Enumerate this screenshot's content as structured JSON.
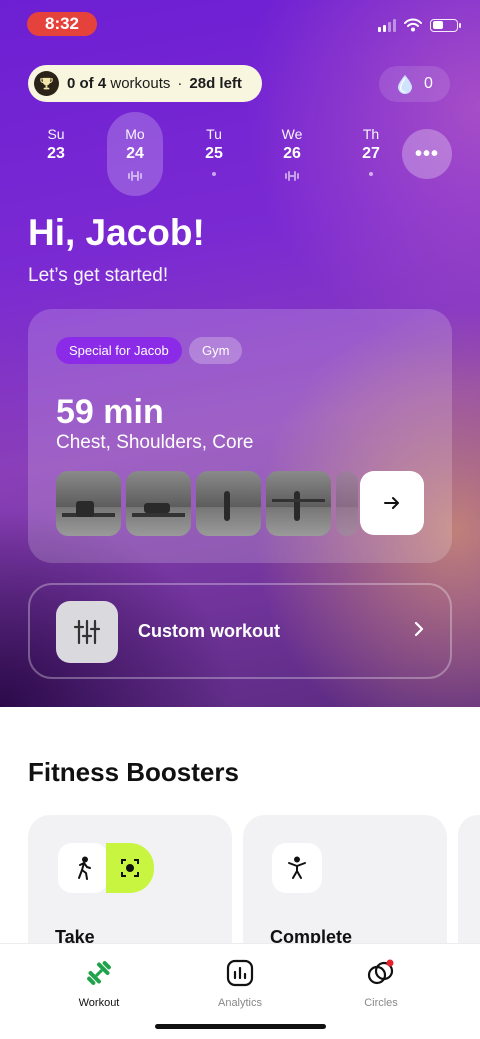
{
  "status_bar": {
    "time": "8:32"
  },
  "progress": {
    "count": "0 of 4",
    "unit": "workouts",
    "separator": "·",
    "days_left": "28d left"
  },
  "drops": {
    "count": "0"
  },
  "days": [
    {
      "name": "Su",
      "num": "23",
      "mark": "none"
    },
    {
      "name": "Mo",
      "num": "24",
      "mark": "dumbbell"
    },
    {
      "name": "Tu",
      "num": "25",
      "mark": "dot"
    },
    {
      "name": "We",
      "num": "26",
      "mark": "dumbbell"
    },
    {
      "name": "Th",
      "num": "27",
      "mark": "dot"
    }
  ],
  "more_label": "•••",
  "greeting": "Hi, Jacob!",
  "subgreeting": "Let’s get started!",
  "workout": {
    "tag_special": "Special for Jacob",
    "tag_type": "Gym",
    "duration": "59 min",
    "muscles": "Chest, Shoulders, Core"
  },
  "custom_workout": {
    "label": "Custom workout"
  },
  "boosters": {
    "title": "Fitness Boosters",
    "cards": [
      {
        "title": "Take"
      },
      {
        "title": "Complete"
      }
    ]
  },
  "tabs": [
    {
      "label": "Workout",
      "active": true
    },
    {
      "label": "Analytics",
      "active": false
    },
    {
      "label": "Circles",
      "active": false
    }
  ],
  "colors": {
    "accent_purple": "#8b2be8",
    "workout_green": "#1fa34a",
    "lime": "#c8f53f",
    "status_red": "#e5423c"
  }
}
